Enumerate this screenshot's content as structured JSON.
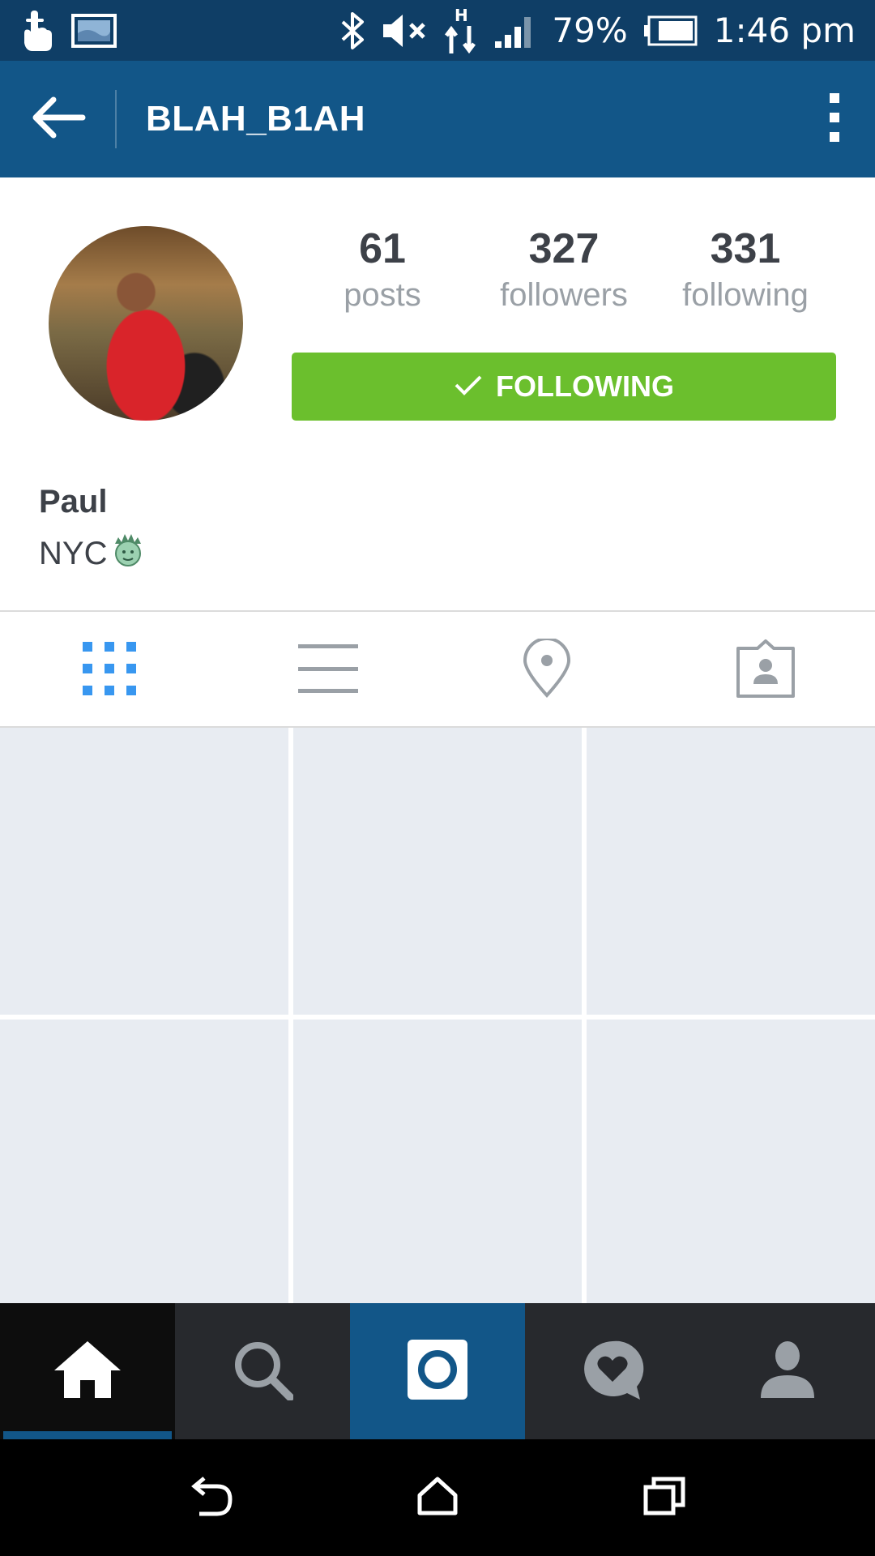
{
  "status_bar": {
    "battery": "79%",
    "time": "1:46 pm",
    "icons": [
      "touch-icon",
      "gallery-icon",
      "bluetooth-icon",
      "mute-icon",
      "hspa-data-icon",
      "signal-icon",
      "battery-icon"
    ]
  },
  "app_bar": {
    "title": "BLAH_B1AH",
    "back_icon": "arrow-left-icon",
    "menu_icon": "more-vertical-icon",
    "color": "#125688"
  },
  "profile": {
    "stats": [
      {
        "value": "61",
        "label": "posts"
      },
      {
        "value": "327",
        "label": "followers"
      },
      {
        "value": "331",
        "label": "following"
      }
    ],
    "follow_button": {
      "label": "FOLLOWING",
      "icon": "check-icon",
      "color": "#6bbf2d"
    },
    "name": "Paul",
    "bio": "NYC",
    "bio_emoji": "statue-of-liberty-icon"
  },
  "view_tabs": [
    {
      "name": "grid",
      "icon": "grid-icon",
      "active": true
    },
    {
      "name": "list",
      "icon": "list-icon",
      "active": false
    },
    {
      "name": "map",
      "icon": "location-pin-icon",
      "active": false
    },
    {
      "name": "tagged",
      "icon": "tagged-photos-icon",
      "active": false
    }
  ],
  "grid": {
    "tile_count": 6,
    "tile_color": "#e8ecf2"
  },
  "bottom_nav": [
    {
      "name": "home",
      "icon": "home-icon",
      "active": true
    },
    {
      "name": "search",
      "icon": "search-icon",
      "active": false
    },
    {
      "name": "camera",
      "icon": "camera-icon",
      "active": false
    },
    {
      "name": "activity",
      "icon": "heart-bubble-icon",
      "active": false
    },
    {
      "name": "profile",
      "icon": "person-icon",
      "active": false
    }
  ],
  "system_nav": [
    "back-icon",
    "home-outline-icon",
    "recents-icon"
  ]
}
